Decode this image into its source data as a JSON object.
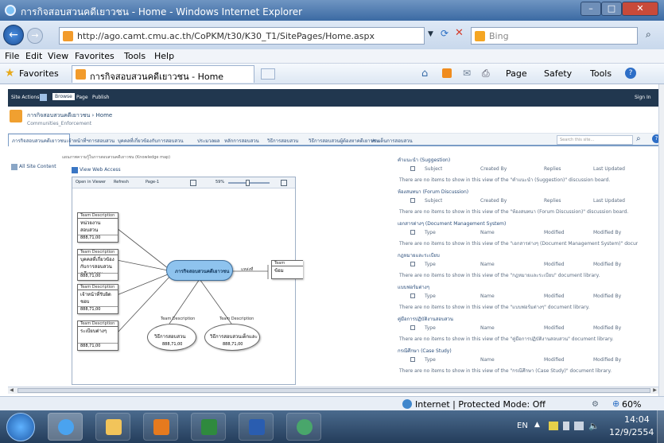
{
  "window": {
    "title": "การกิจสอบสวนคดีเยาวชน - Home - Windows Internet Explorer"
  },
  "address_bar": {
    "url": "http://ago.camt.cmu.ac.th/CoPKM/t30/K30_T1/SitePages/Home.aspx",
    "search_engine": "Bing"
  },
  "menu": [
    "File",
    "Edit",
    "View",
    "Favorites",
    "Tools",
    "Help"
  ],
  "favorites": {
    "label": "Favorites",
    "tab_title": "การกิจสอบสวนคดีเยาวชน - Home"
  },
  "command_bar": {
    "page": "Page",
    "safety": "Safety",
    "tools": "Tools"
  },
  "sp_ribbon": {
    "site_actions": "Site Actions",
    "tabs": [
      "Browse",
      "Page",
      "Publish"
    ],
    "sign_in": "Sign In"
  },
  "sp_header": {
    "breadcrumb": "การกิจสอบสวนคดีเยาวชน › Home",
    "subtitle": "Communities_Enforcement"
  },
  "top_nav": {
    "items": [
      "ภารกิจสอบสวนคดีเยาวชน",
      "เจ้าหน้าที่ฯการสอบสวน",
      "บุคคลที่เกี่ยวข้องกับการสอบสวน",
      "ประมวลผล",
      "หลักการสอบสวน",
      "วิธีการสอบสวน",
      "วิธีการสอบสวนผู้ต้องหาคดีเยาวชน",
      "ประเด็นการสอบสวน"
    ],
    "search_placeholder": "Search this site..."
  },
  "left_panel": {
    "all_site_content": "All Site Content"
  },
  "diagram": {
    "caption": "แผนภาพความรู้ในการสอบสวนคดีเยาวชน (Knowledge map)",
    "open_link": "View Web Access",
    "toolbar": {
      "open_in_viewer": "Open in Viewer",
      "refresh": "Refresh",
      "page": "Page-1",
      "zoom": "59%"
    },
    "center_node": "ภารกิจสอบสวนคดีเยาวชน",
    "connector_label": "แหล่งที่",
    "left_nodes": [
      {
        "header": "Team Description",
        "title": "หน่วยงานสอบสวน",
        "footer": "888,71,00"
      },
      {
        "header": "Team Description",
        "title": "บุคคลที่เกี่ยวข้องกับการสอบสวนคดีเยาวชน",
        "footer": "888,71,00"
      },
      {
        "header": "Team Description",
        "title": "เจ้าหน้าที่รับผิดชอบ",
        "footer": "888,71,00"
      },
      {
        "header": "Team Description",
        "title": "ระเบียบต่างๆ",
        "footer": "888,71,00"
      }
    ],
    "bottom_nodes": [
      {
        "header": "Team Description",
        "title": "วิธีการสอบสวน",
        "footer": "888,71,00"
      },
      {
        "header": "Team Description",
        "title": "วิธีการสอบสวนเด็กและเยาวชน",
        "footer": "888,71,00"
      }
    ],
    "right_node": {
      "header": "Team",
      "title": "ข้อม"
    }
  },
  "right_lists": [
    {
      "title": "คำแนะนำ (Suggestion)",
      "columns": [
        "Subject",
        "Created By",
        "Replies",
        "Last Updated"
      ],
      "empty": "There are no items to show in this view of the \"คำแนะนำ (Suggestion)\" discussion board."
    },
    {
      "title": "ห้องสนทนา (Forum Discussion)",
      "columns": [
        "Subject",
        "Created By",
        "Replies",
        "Last Updated"
      ],
      "empty": "There are no items to show in this view of the \"ห้องสนทนา (Forum Discussion)\" discussion board."
    },
    {
      "title": "เอกสารต่างๆ (Document Management System)",
      "columns": [
        "Type",
        "Name",
        "Modified",
        "Modified By"
      ],
      "empty": "There are no items to show in this view of the \"เอกสารต่างๆ (Document Management System)\" document library."
    },
    {
      "title": "กฎหมายและระเบียบ",
      "columns": [
        "Type",
        "Name",
        "Modified",
        "Modified By"
      ],
      "empty": "There are no items to show in this view of the \"กฎหมายและระเบียบ\" document library."
    },
    {
      "title": "แบบฟอร์มต่างๆ",
      "columns": [
        "Type",
        "Name",
        "Modified",
        "Modified By"
      ],
      "empty": "There are no items to show in this view of the \"แบบฟอร์มต่างๆ\" document library."
    },
    {
      "title": "คู่มือการปฏิบัติงานสอบสวน",
      "columns": [
        "Type",
        "Name",
        "Modified",
        "Modified By"
      ],
      "empty": "There are no items to show in this view of the \"คู่มือการปฏิบัติงานสอบสวน\" document library."
    },
    {
      "title": "กรณีศึกษา (Case Study)",
      "columns": [
        "Type",
        "Name",
        "Modified",
        "Modified By"
      ],
      "empty": "There are no items to show in this view of the \"กรณีศึกษา (Case Study)\" document library."
    }
  ],
  "statusbar": {
    "zone": "Internet | Protected Mode: Off",
    "zoom": "60%"
  },
  "taskbar": {
    "language": "EN",
    "time": "14:04",
    "date": "12/9/2554"
  },
  "colors": {
    "ie_frame": "#3b6aa3",
    "sp_ribbon": "#21374f",
    "nav_accent": "#7a9cc6",
    "link_blue": "#2a4d7a",
    "center_node_fill": "#8ec3ee",
    "taskbar": "#243d5b"
  }
}
